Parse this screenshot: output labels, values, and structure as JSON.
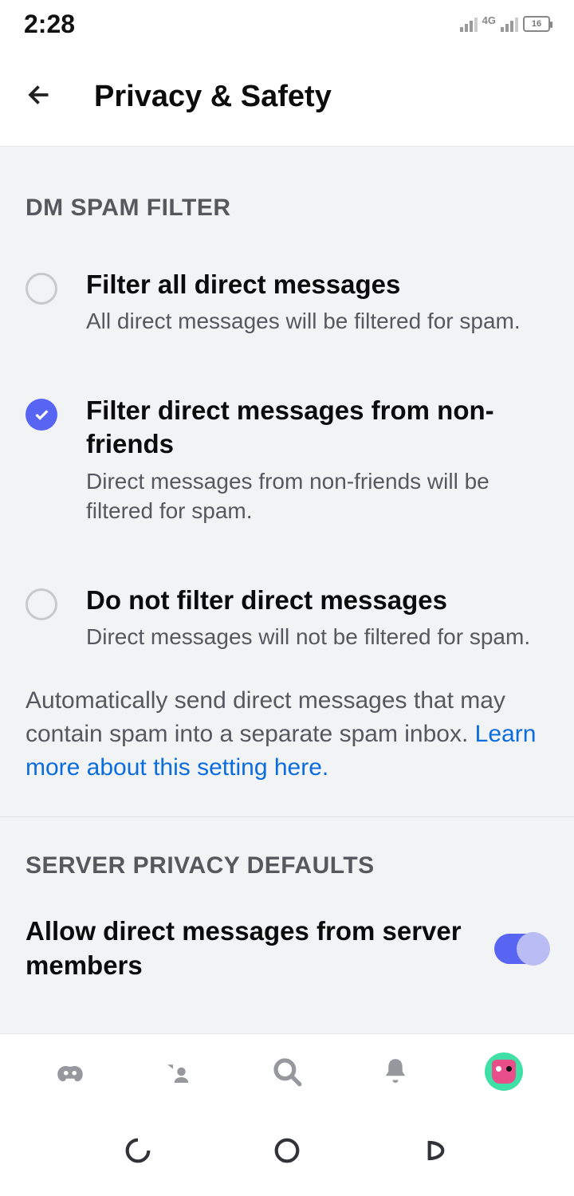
{
  "status": {
    "time": "2:28",
    "network_label": "4G",
    "battery_text": "16"
  },
  "header": {
    "title": "Privacy & Safety"
  },
  "spam_section": {
    "header": "DM SPAM FILTER",
    "options": [
      {
        "title": "Filter all direct messages",
        "sub": "All direct messages will be filtered for spam.",
        "selected": false
      },
      {
        "title": "Filter direct messages from non-friends",
        "sub": "Direct messages from non-friends will be filtered for spam.",
        "selected": true
      },
      {
        "title": "Do not filter direct messages",
        "sub": "Direct messages will not be filtered for spam.",
        "selected": false
      }
    ],
    "footer_text": "Automatically send direct messages that may contain spam into a separate spam inbox. ",
    "footer_link": "Learn more about this setting here."
  },
  "server_section": {
    "header": "SERVER PRIVACY DEFAULTS",
    "allow_dm_label": "Allow direct messages from server members",
    "allow_dm_on": true
  }
}
